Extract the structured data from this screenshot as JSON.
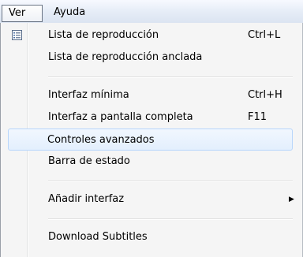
{
  "menubar": {
    "items": [
      {
        "label": "Ver",
        "active": true
      },
      {
        "label": "Ayuda",
        "active": false
      }
    ]
  },
  "menu": {
    "items": [
      {
        "label": "Lista de reproducción",
        "shortcut": "Ctrl+L",
        "icon": "playlist-icon"
      },
      {
        "label": "Lista de reproducción anclada",
        "shortcut": ""
      },
      {
        "label": "Interfaz mínima",
        "shortcut": "Ctrl+H"
      },
      {
        "label": "Interfaz a pantalla completa",
        "shortcut": "F11"
      },
      {
        "label": "Controles avanzados",
        "shortcut": "",
        "highlighted": true
      },
      {
        "label": "Barra de estado",
        "shortcut": ""
      },
      {
        "label": "Añadir interfaz",
        "shortcut": "",
        "submenu_arrow": "▶"
      },
      {
        "label": "Download Subtitles",
        "shortcut": ""
      }
    ]
  },
  "colors": {
    "highlight_border": "#b8d6fb",
    "menu_background": "#f5f5f5"
  }
}
